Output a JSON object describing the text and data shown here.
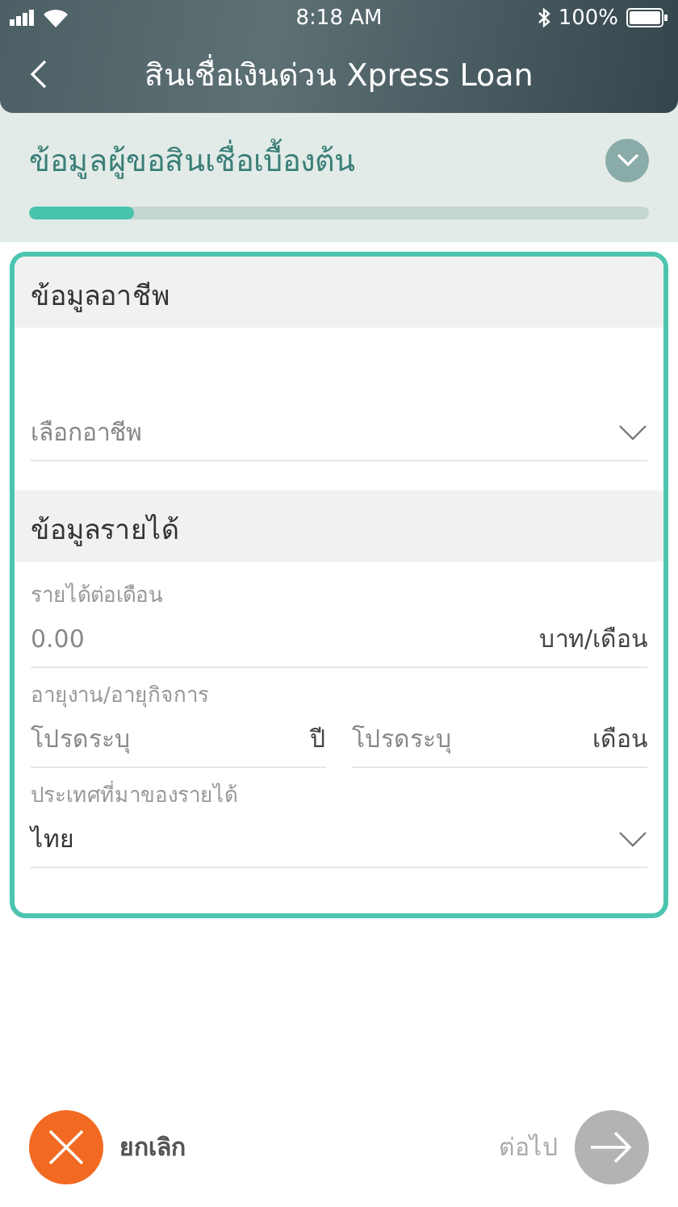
{
  "status_bar": {
    "time": "8:18 AM",
    "battery": "100%"
  },
  "header": {
    "title": "สินเชื่อเงินด่วน Xpress Loan"
  },
  "step": {
    "title": "ข้อมูลผู้ขอสินเชื่อเบื้องต้น",
    "level": 0.17
  },
  "sections": [
    {
      "title": "ข้อมูลอาชีพ",
      "fields": [
        {
          "kind": "select",
          "placeholder": "เลือกอาชีพ"
        }
      ]
    },
    {
      "title": "ข้อมูลรายได้",
      "fields": [
        {
          "kind": "input",
          "label": "รายได้ต่อเดือน",
          "placeholder": "0.00",
          "unit": "บาท/เดือน"
        },
        {
          "kind": "pair",
          "label": "อายุงาน/อายุกิจการ",
          "inputs": [
            {
              "placeholder": "โปรดระบุ",
              "unit": "ปี"
            },
            {
              "placeholder": "โปรดระบุ",
              "unit": "เดือน"
            }
          ]
        },
        {
          "kind": "select",
          "label": "ประเทศที่มาของรายได้",
          "value": "ไทย"
        }
      ]
    }
  ],
  "footer": {
    "cancel": "ยกเลิก",
    "next": {
      "label": "ต่อไป",
      "disabled": true
    }
  }
}
